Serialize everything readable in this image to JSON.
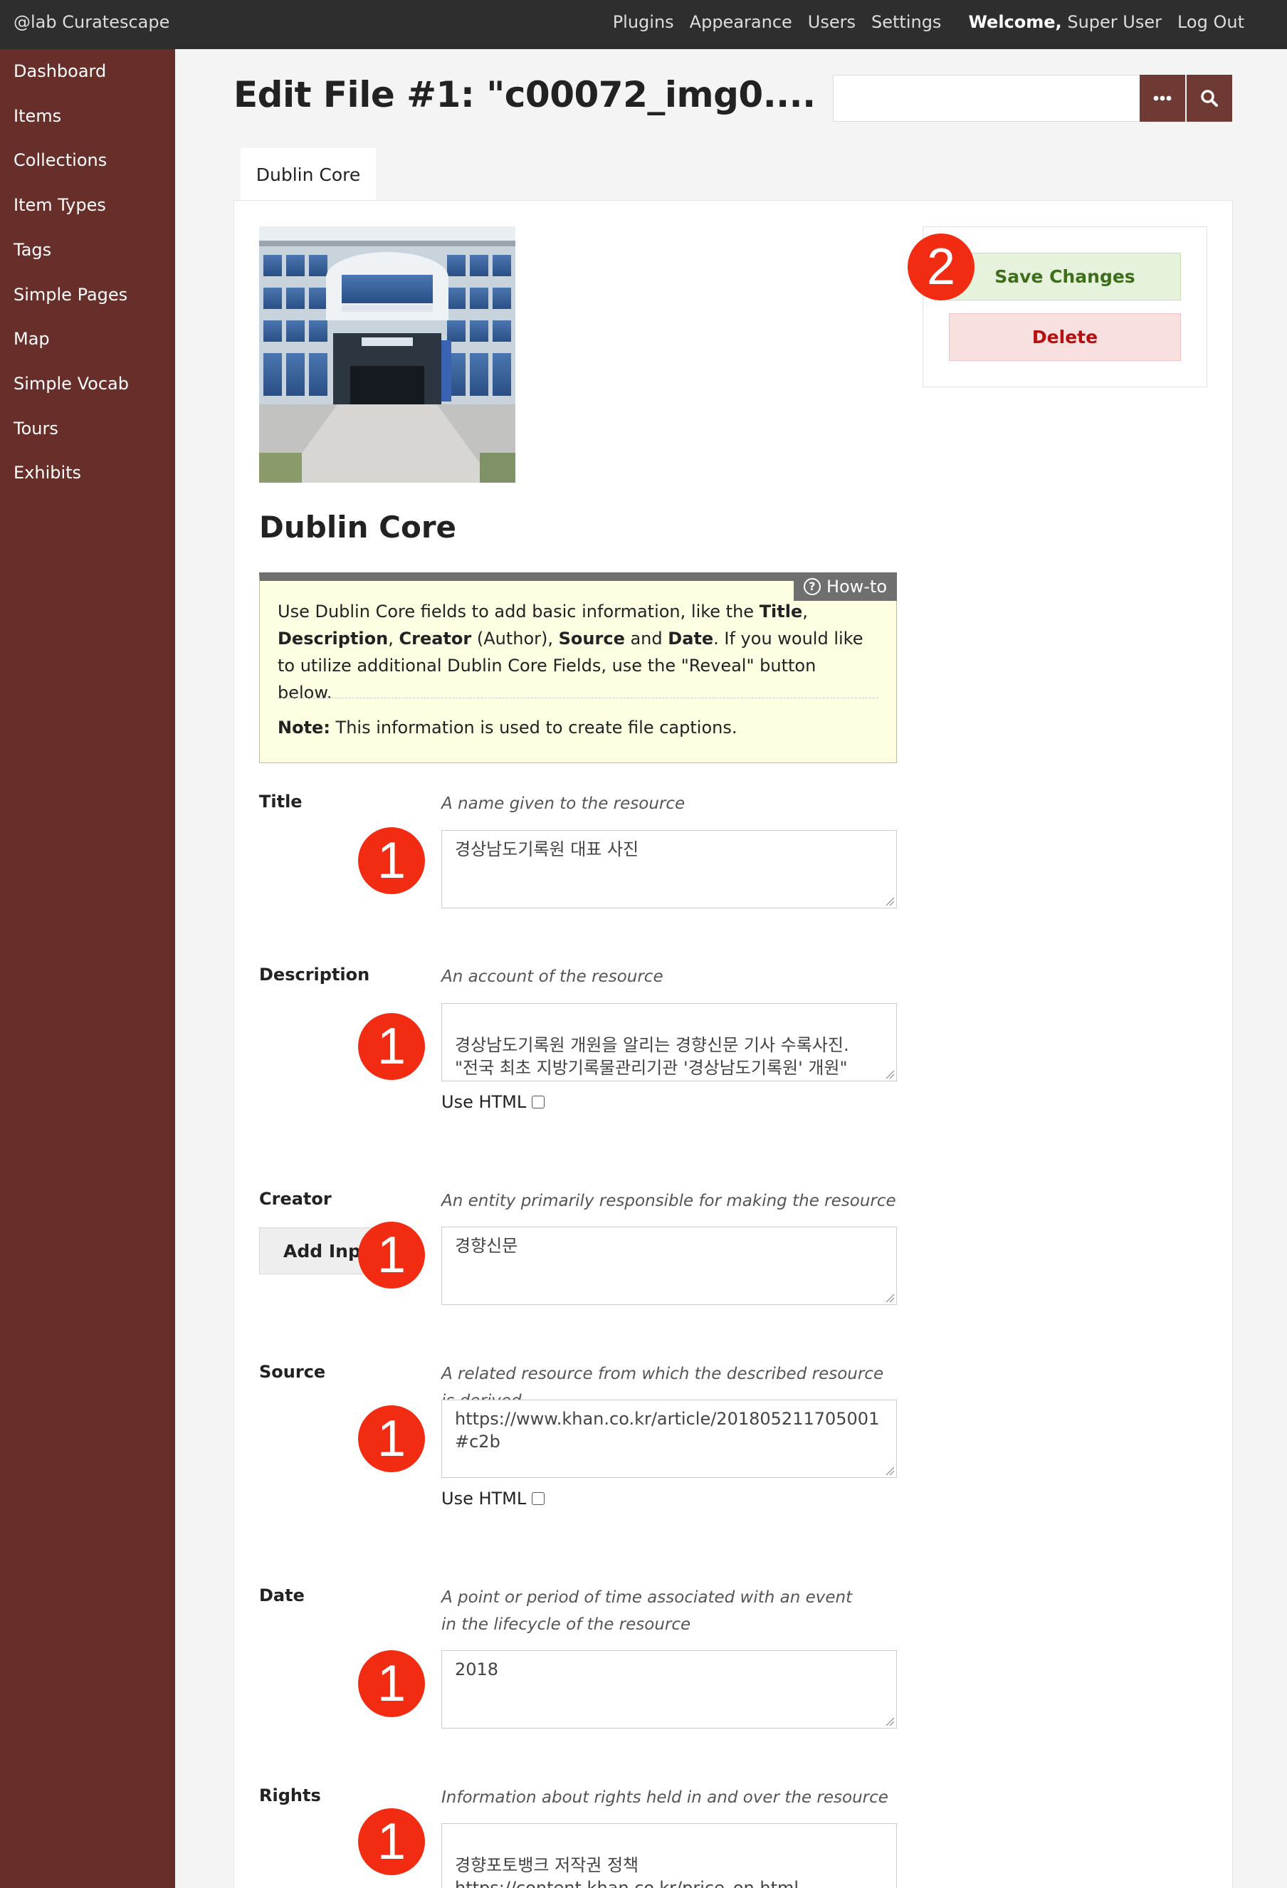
{
  "topbar": {
    "brand": "@lab Curatescape",
    "nav": [
      "Plugins",
      "Appearance",
      "Users",
      "Settings"
    ],
    "welcome_label": "Welcome,",
    "user_name": "Super User",
    "logout": "Log Out"
  },
  "sidebar": {
    "items": [
      "Dashboard",
      "Items",
      "Collections",
      "Item Types",
      "Tags",
      "Simple Pages",
      "Map",
      "Simple Vocab",
      "Tours",
      "Exhibits"
    ]
  },
  "page": {
    "title": "Edit File #1: \"c00072_img0...."
  },
  "search": {
    "advanced_icon": "ellipsis-icon",
    "submit_icon": "search-icon"
  },
  "tabs": [
    "Dublin Core"
  ],
  "actions": {
    "save": "Save Changes",
    "delete": "Delete"
  },
  "section_title": "Dublin Core",
  "howto": {
    "tab_label": "How-to",
    "text_1": "Use Dublin Core fields to add basic information, like the ",
    "title_word": "Title",
    "comma1": ",",
    "description_word": "Description",
    "comma2": ", ",
    "creator_word": "Creator",
    "text_2": " (Author), ",
    "source_word": "Source",
    "text_3": " and ",
    "date_word": "Date",
    "text_4": ". If you would like to utilize additional Dublin Core Fields, use the \"Reveal\" button below.",
    "note_label": "Note:",
    "note_text": " This information is used to create file captions."
  },
  "fields": {
    "title": {
      "label": "Title",
      "hint": "A name given to the resource",
      "value": "경상남도기록원 대표 사진"
    },
    "description": {
      "label": "Description",
      "hint": "An account of the resource",
      "value": "경상남도기록원 개원을 알리는 경향신문 기사 수록사진.\n\"전국 최초 지방기록물관리기관 '경상남도기록원' 개원\"",
      "use_html": "Use HTML"
    },
    "creator": {
      "label": "Creator",
      "hint": "An entity primarily responsible for making the resource",
      "value": "경향신문",
      "add_input": "Add Input"
    },
    "source": {
      "label": "Source",
      "hint": "A related resource from which the described resource is derived",
      "value": "https://www.khan.co.kr/article/201805211705001#c2b",
      "use_html": "Use HTML"
    },
    "date": {
      "label": "Date",
      "hint": "A point or period of time associated with an event in the lifecycle of the resource",
      "value": "2018"
    },
    "rights": {
      "label": "Rights",
      "hint": "Information about rights held in and over the resource",
      "value": "경향포토뱅크 저작권 정책\nhttps://content.khan.co.kr/price_on.html"
    }
  },
  "markers": {
    "one": "1",
    "two": "2"
  },
  "colors": {
    "topbar": "#2e2e2e",
    "sidebar": "#682e2a",
    "accent": "#6e3a33",
    "marker": "#f22c12"
  }
}
